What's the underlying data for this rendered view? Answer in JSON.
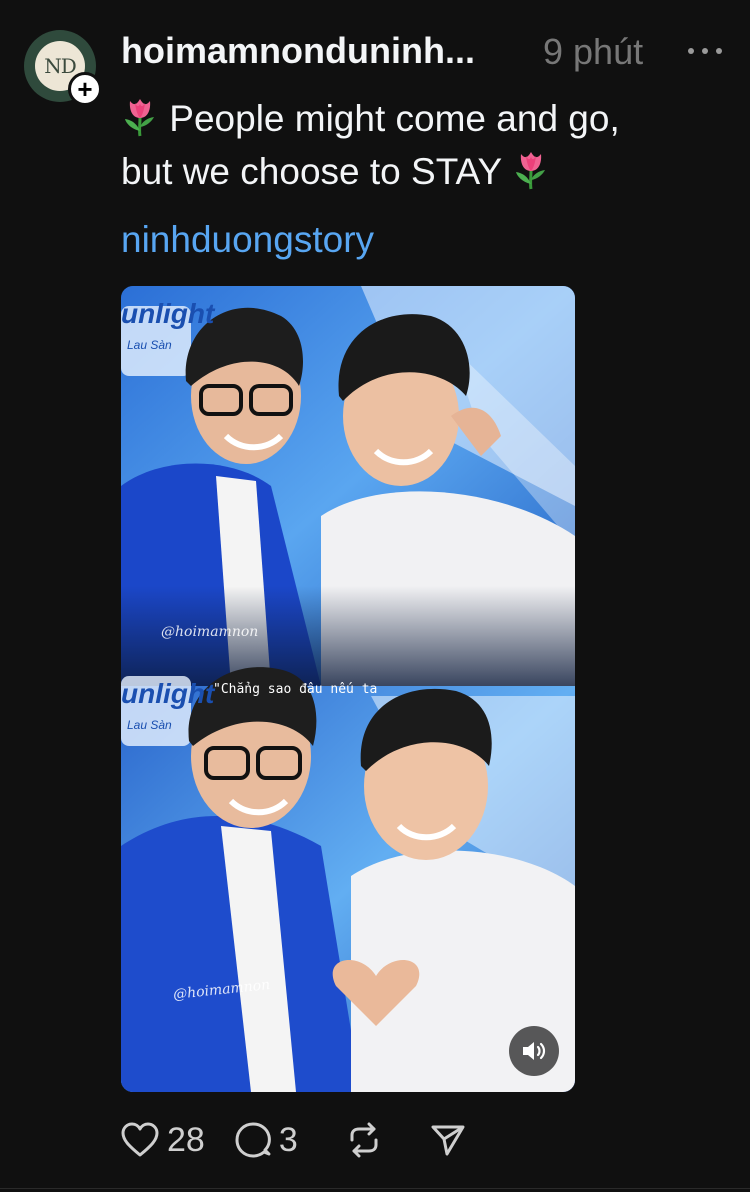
{
  "post": {
    "author": {
      "username": "hoimamnonduninh...",
      "avatar_text": "ND"
    },
    "timestamp": "9 phút",
    "caption_line1": "People might come and go,",
    "caption_line2": "but we choose to STAY",
    "emoji": "tulip",
    "tag": "ninhduongstory",
    "media": {
      "top_watermark": "@hoimamnon",
      "bottom_watermark": "@hoimamnon",
      "subtitle": "\"Chẳng sao đâu nếu ta",
      "brand_text_top": "unlight",
      "brand_sub_top": "Lau Sàn",
      "brand_text_bottom": "unlight",
      "brand_sub_bottom": "Lau Sàn",
      "sound_icon": "speaker-icon"
    },
    "actions": {
      "like_count": "28",
      "reply_count": "3"
    }
  },
  "colors": {
    "background": "#101010",
    "text": "#f3f5f7",
    "muted": "#777777",
    "tag": "#58a6f2"
  }
}
